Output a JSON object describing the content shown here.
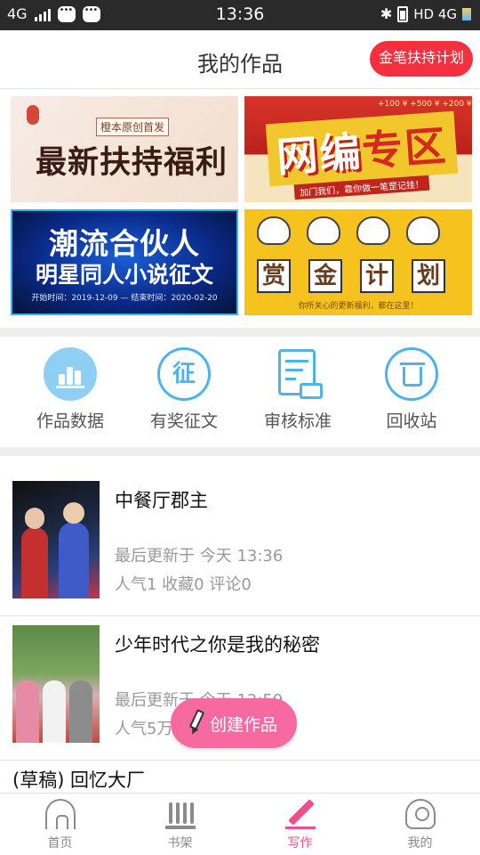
{
  "status_bar": {
    "network_left": "4G",
    "time": "13:36",
    "network_right": "HD 4G"
  },
  "header": {
    "title": "我的作品",
    "support_plan_button": "金笔扶持计划"
  },
  "banners": [
    {
      "title": "最新扶持福利",
      "subtitle": "橙本原创首发"
    },
    {
      "title_part1": "网编",
      "title_part2": "专区",
      "tag": "加门我们，靠你做一笔罡记挂！",
      "coins": "+100 ¥   +500 ¥   +200 ¥"
    },
    {
      "line1": "潮流合伙人",
      "line2": "明星同人小说征文",
      "dates": "开始时间：2019-12-09 — 结束时间：2020-02-20"
    },
    {
      "chars": [
        "赏",
        "金",
        "计",
        "划"
      ],
      "note": "你所关心的更新福利，都在这里！"
    }
  ],
  "actions": [
    {
      "label": "作品数据",
      "icon": "stats-icon"
    },
    {
      "label": "有奖征文",
      "icon": "contest-icon",
      "glyph": "征"
    },
    {
      "label": "审核标准",
      "icon": "review-icon"
    },
    {
      "label": "回收站",
      "icon": "trash-icon"
    }
  ],
  "works": [
    {
      "name": "中餐厅郡主",
      "updated": "最后更新于 今天 13:36",
      "stats": "人气1 收藏0 评论0"
    },
    {
      "name": "少年时代之你是我的秘密",
      "updated": "最后更新于 今天 12:59",
      "stats": "人气5万 收藏 1 评论 6"
    },
    {
      "name": "(草稿) 回忆大厂"
    }
  ],
  "fab": {
    "label": "创建作品",
    "icon": "pencil-icon"
  },
  "bottom_nav": [
    {
      "label": "首页",
      "icon": "home-icon"
    },
    {
      "label": "书架",
      "icon": "bookshelf-icon"
    },
    {
      "label": "写作",
      "icon": "write-icon",
      "active": true
    },
    {
      "label": "我的",
      "icon": "profile-icon"
    }
  ],
  "colors": {
    "accent_red": "#f4303f",
    "pink": "#f66aa1",
    "nav_active": "#f14f8b",
    "icon_blue": "#4fb3ea"
  }
}
